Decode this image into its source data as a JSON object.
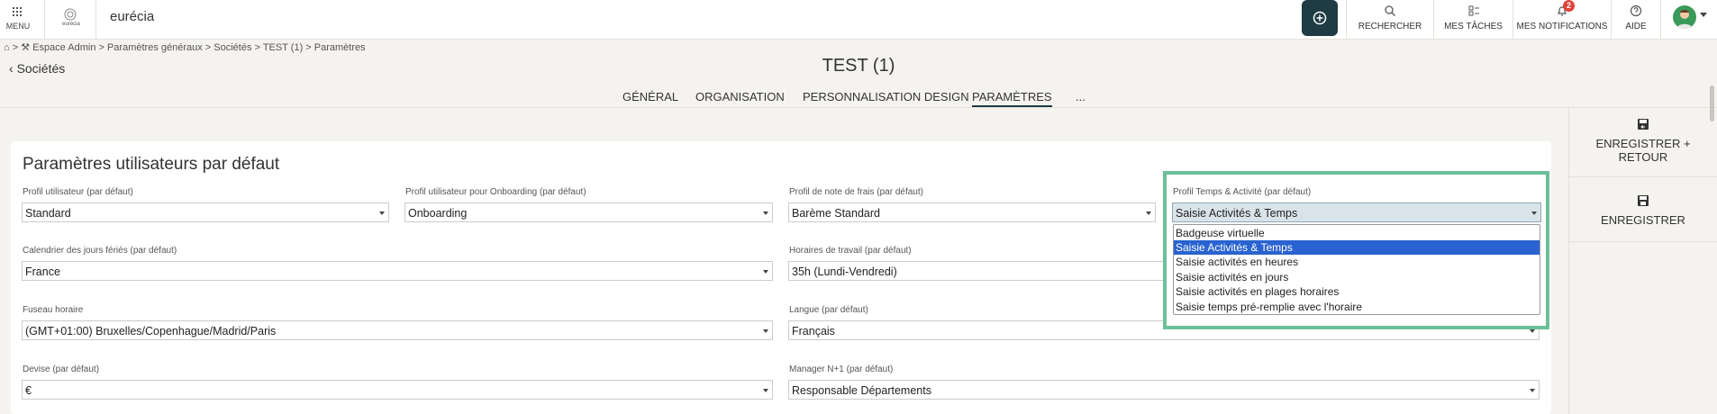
{
  "topbar": {
    "menu_label": "MENU",
    "logo_text": "eurécia",
    "app_name": "eurécia",
    "nav": [
      {
        "label": "RECHERCHER",
        "icon": "search-icon"
      },
      {
        "label": "MES TÂCHES",
        "icon": "tasks-icon"
      },
      {
        "label": "MES NOTIFICATIONS",
        "icon": "bell-icon",
        "badge": "2"
      },
      {
        "label": "AIDE",
        "icon": "help-icon"
      }
    ],
    "accent": "#1f3b43"
  },
  "breadcrumb": "> ⚒ Espace Admin > Paramètres généraux > Sociétés > TEST (1) > Paramètres",
  "back_label": "Sociétés",
  "page_title": "TEST (1)",
  "tabs": [
    {
      "label": "GÉNÉRAL",
      "active": false
    },
    {
      "label": "ORGANISATION",
      "active": false
    },
    {
      "label": "PERSONNALISATION DESIGN",
      "active": false
    },
    {
      "label": "PARAMÈTRES",
      "active": true
    },
    {
      "label": "...",
      "active": false
    }
  ],
  "section_title": "Paramètres utilisateurs par défaut",
  "fields": {
    "profil_utilisateur": {
      "label": "Profil utilisateur (par défaut)",
      "value": "Standard"
    },
    "profil_onboarding": {
      "label": "Profil utilisateur pour Onboarding (par défaut)",
      "value": "Onboarding"
    },
    "profil_note_frais": {
      "label": "Profil de note de frais (par défaut)",
      "value": "Barème Standard"
    },
    "profil_temps": {
      "label": "Profil Temps & Activité (par défaut)",
      "value": "Saisie Activités & Temps"
    },
    "calendrier": {
      "label": "Calendrier des jours fériés (par défaut)",
      "value": "France"
    },
    "horaires": {
      "label": "Horaires de travail (par défaut)",
      "value": "35h (Lundi-Vendredi)"
    },
    "fuseau": {
      "label": "Fuseau horaire",
      "value": "(GMT+01:00) Bruxelles/Copenhague/Madrid/Paris"
    },
    "langue": {
      "label": "Langue (par défaut)",
      "value": "Français"
    },
    "devise": {
      "label": "Devise (par défaut)",
      "value": "€"
    },
    "manager": {
      "label": "Manager N+1 (par défaut)",
      "value": "Responsable Départements"
    }
  },
  "dropdown_options": [
    "Badgeuse virtuelle",
    "Saisie Activités & Temps",
    "Saisie activités en heures",
    "Saisie activités en jours",
    "Saisie activités en plages horaires",
    "Saisie temps pré-remplie avec l'horaire"
  ],
  "selected_option_index": 1,
  "actions": {
    "save_return": "ENREGISTRER + RETOUR",
    "save": "ENREGISTRER"
  },
  "highlight_color": "#6dbf99"
}
